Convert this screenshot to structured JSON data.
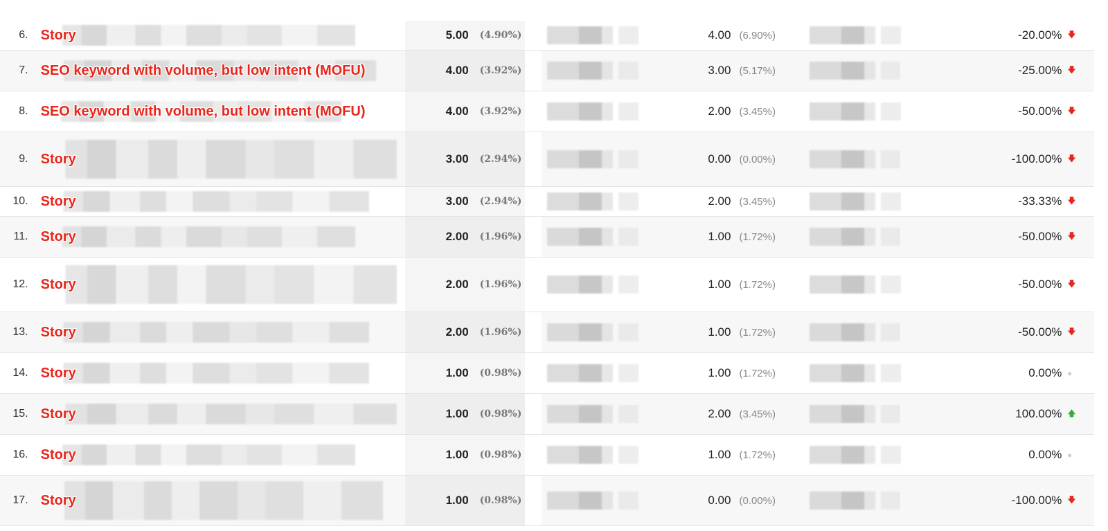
{
  "rows": [
    {
      "index": "6.",
      "keyword": "Story",
      "metric1": "5.00",
      "pct1": "(4.90%)",
      "metric2": "4.00",
      "pct2": "(6.90%)",
      "change": "-20.00%",
      "trend": "down"
    },
    {
      "index": "7.",
      "keyword": "SEO keyword with volume, but low intent (MOFU)",
      "metric1": "4.00",
      "pct1": "(3.92%)",
      "metric2": "3.00",
      "pct2": "(5.17%)",
      "change": "-25.00%",
      "trend": "down"
    },
    {
      "index": "8.",
      "keyword": "SEO keyword with volume, but low intent (MOFU)",
      "metric1": "4.00",
      "pct1": "(3.92%)",
      "metric2": "2.00",
      "pct2": "(3.45%)",
      "change": "-50.00%",
      "trend": "down"
    },
    {
      "index": "9.",
      "keyword": "Story",
      "metric1": "3.00",
      "pct1": "(2.94%)",
      "metric2": "0.00",
      "pct2": "(0.00%)",
      "change": "-100.00%",
      "trend": "down"
    },
    {
      "index": "10.",
      "keyword": "Story",
      "metric1": "3.00",
      "pct1": "(2.94%)",
      "metric2": "2.00",
      "pct2": "(3.45%)",
      "change": "-33.33%",
      "trend": "down"
    },
    {
      "index": "11.",
      "keyword": "Story",
      "metric1": "2.00",
      "pct1": "(1.96%)",
      "metric2": "1.00",
      "pct2": "(1.72%)",
      "change": "-50.00%",
      "trend": "down"
    },
    {
      "index": "12.",
      "keyword": "Story",
      "metric1": "2.00",
      "pct1": "(1.96%)",
      "metric2": "1.00",
      "pct2": "(1.72%)",
      "change": "-50.00%",
      "trend": "down"
    },
    {
      "index": "13.",
      "keyword": "Story",
      "metric1": "2.00",
      "pct1": "(1.96%)",
      "metric2": "1.00",
      "pct2": "(1.72%)",
      "change": "-50.00%",
      "trend": "down"
    },
    {
      "index": "14.",
      "keyword": "Story",
      "metric1": "1.00",
      "pct1": "(0.98%)",
      "metric2": "1.00",
      "pct2": "(1.72%)",
      "change": "0.00%",
      "trend": "flat"
    },
    {
      "index": "15.",
      "keyword": "Story",
      "metric1": "1.00",
      "pct1": "(0.98%)",
      "metric2": "2.00",
      "pct2": "(3.45%)",
      "change": "100.00%",
      "trend": "up"
    },
    {
      "index": "16.",
      "keyword": "Story",
      "metric1": "1.00",
      "pct1": "(0.98%)",
      "metric2": "1.00",
      "pct2": "(1.72%)",
      "change": "0.00%",
      "trend": "flat"
    },
    {
      "index": "17.",
      "keyword": "Story",
      "metric1": "1.00",
      "pct1": "(0.98%)",
      "metric2": "0.00",
      "pct2": "(0.00%)",
      "change": "-100.00%",
      "trend": "down"
    }
  ],
  "trend_glyphs": {
    "down": "🡇",
    "up": "🡅",
    "flat": "●"
  },
  "trend_icons": {
    "down": "arrow-down-icon",
    "up": "arrow-up-icon",
    "flat": "dot-icon"
  },
  "colors": {
    "label_red": "#e8261b",
    "up_green": "#3aaa3a",
    "flat_grey": "#c9c9c9"
  }
}
